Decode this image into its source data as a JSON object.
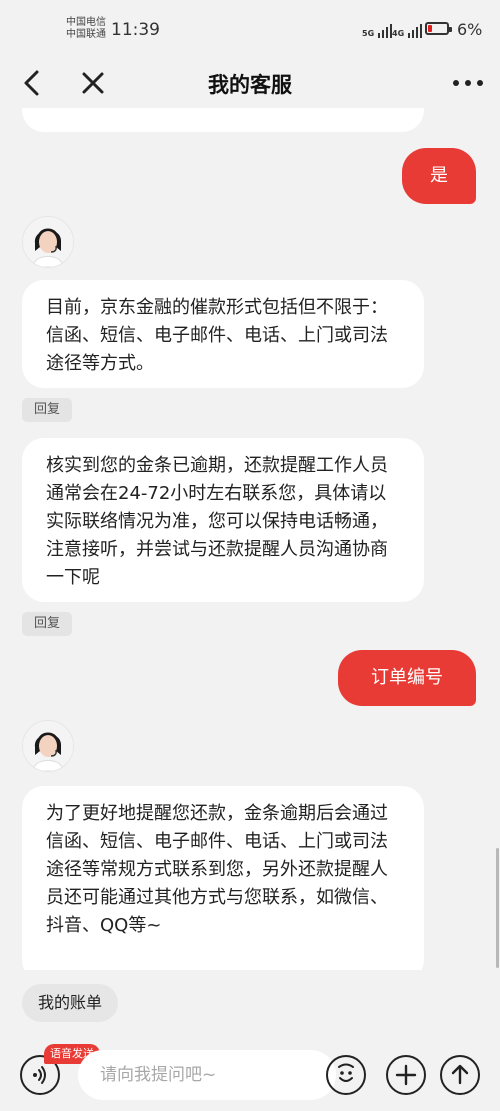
{
  "status_bar": {
    "carrier_1": "中国电信",
    "carrier_2": "中国联通",
    "time": "11:39",
    "net_1": "5G",
    "net_2": "4G",
    "battery_level_pct": 6,
    "battery_text": "6%",
    "battery_color": "#e02020"
  },
  "nav": {
    "back_icon": "chevron-left-icon",
    "close_icon": "close-icon",
    "title": "我的客服",
    "more_icon": "more-dots-icon"
  },
  "chat": {
    "bubble_1": "目前，京东金融的催款形式包括但不限于：信函、短信、电子邮件、电话、上门或司法途径等方式。",
    "bubble_2": "核实到您的金条已逾期，还款提醒工作人员通常会在24-72小时左右联系您，具体请以实际联络情况为准，您可以保持电话畅通，注意接听，并尝试与还款提醒人员沟通协商一下呢",
    "bubble_3": "为了更好地提醒您还款，金条逾期后会通过信函、短信、电子邮件、电话、上门或司法途径等常规方式联系到您，另外还款提醒人员还可能通过其他方式与您联系，如微信、抖音、QQ等~",
    "user_msg_1": "是",
    "user_msg_2": "订单编号",
    "reply_label": "回复",
    "accent_color": "#e93b35"
  },
  "quick_reply": {
    "label": "我的账单"
  },
  "input_bar": {
    "voice_badge": "语音发送",
    "placeholder": "请向我提问吧~",
    "voice_icon": "voice-wave-icon",
    "emoji_icon": "emoji-icon",
    "plus_icon": "plus-icon",
    "send_icon": "arrow-up-icon"
  }
}
